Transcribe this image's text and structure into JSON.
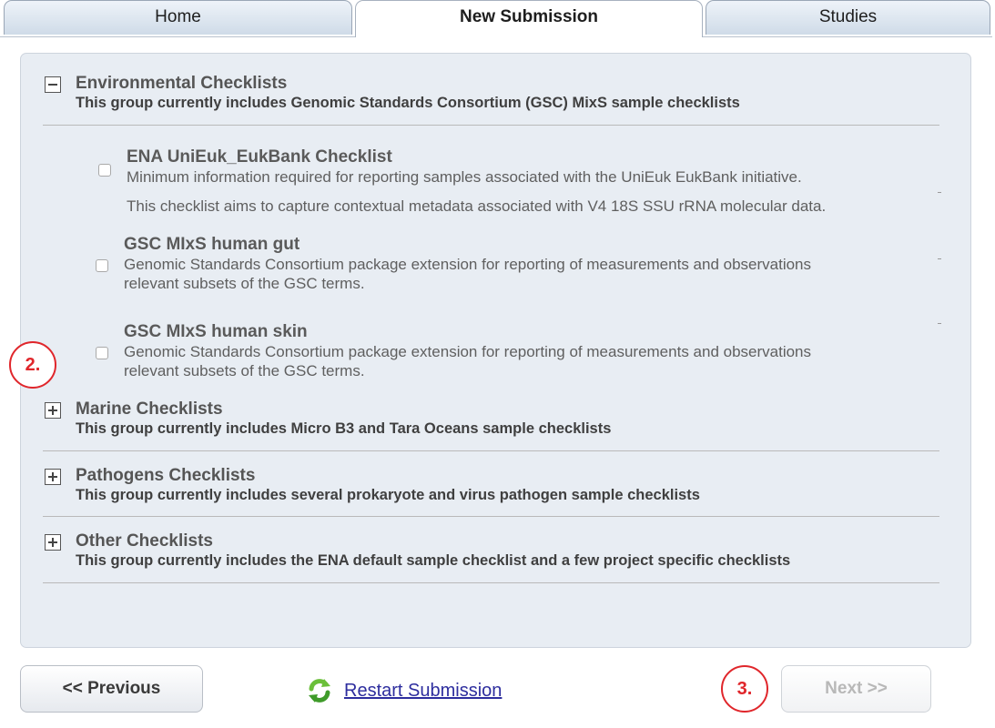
{
  "tabs": [
    {
      "label": "Home"
    },
    {
      "label": "New Submission"
    },
    {
      "label": "Studies"
    }
  ],
  "groups": [
    {
      "title": "Environmental Checklists",
      "description": "This group currently includes Genomic Standards Consortium (GSC) MixS sample checklists",
      "expanded": true,
      "items": [
        {
          "title": "ENA UniEuk_EukBank Checklist",
          "description": "Minimum information required for reporting samples associated with the UniEuk EukBank initiative.",
          "note": "This checklist aims to capture contextual metadata associated with V4 18S SSU rRNA molecular data."
        },
        {
          "title": "GSC MIxS human gut",
          "description_line1": "Genomic Standards Consortium package extension for reporting of measurements and observations",
          "description_line2": "relevant subsets of the GSC terms."
        },
        {
          "title": "GSC MIxS human skin",
          "description_line1": "Genomic Standards Consortium package extension for reporting of measurements and observations",
          "description_line2": "relevant subsets of the GSC terms."
        }
      ]
    },
    {
      "title": "Marine Checklists",
      "description": "This group currently includes Micro B3 and Tara Oceans sample checklists",
      "expanded": false
    },
    {
      "title": "Pathogens Checklists",
      "description": "This group currently includes several prokaryote and virus pathogen sample checklists",
      "expanded": false
    },
    {
      "title": "Other Checklists",
      "description": "This group currently includes the ENA default sample checklist and a few project specific checklists",
      "expanded": false
    }
  ],
  "callouts": {
    "two": "2.",
    "three": "3."
  },
  "buttons": {
    "previous": "<< Previous",
    "restart": "Restart Submission",
    "next": "Next >>"
  },
  "icons": {
    "expanded": "minus-icon",
    "collapsed": "plus-icon",
    "restart": "refresh-icon"
  },
  "colors": {
    "callout": "#e0262b",
    "panel_bg": "#e8edf3",
    "link": "#2d2d9e"
  }
}
